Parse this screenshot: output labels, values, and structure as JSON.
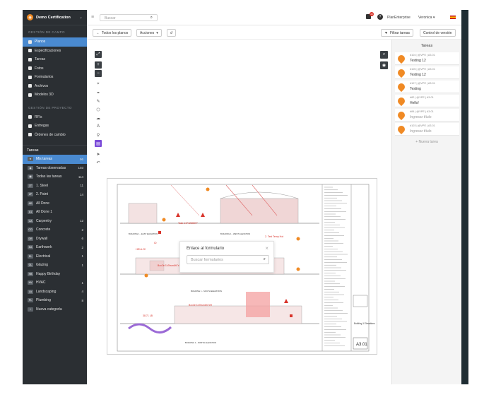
{
  "sidebar": {
    "brand": "Demo Certification",
    "section_field": "GESTIÓN DE CAMPO",
    "field_items": [
      {
        "label": "Planos",
        "icon": "map-icon",
        "active": true
      },
      {
        "label": "Especificaciones",
        "icon": "doc-icon"
      },
      {
        "label": "Tareas",
        "icon": "list-icon"
      },
      {
        "label": "Fotos",
        "icon": "camera-icon"
      },
      {
        "label": "Formularios",
        "icon": "form-icon"
      },
      {
        "label": "Archivos",
        "icon": "attach-icon"
      },
      {
        "label": "Modelos 3D",
        "icon": "cube-icon"
      }
    ],
    "section_project": "GESTIÓN DE PROYECTO",
    "project_items": [
      {
        "label": "RFIs",
        "icon": "rfi-icon"
      },
      {
        "label": "Entregas",
        "icon": "person-icon"
      },
      {
        "label": "Órdenes de cambio",
        "icon": "change-icon"
      }
    ],
    "tasks_header": "Tareas",
    "task_filters": [
      {
        "badge": "★",
        "label": "Mis tareas",
        "count": "96",
        "active": true
      },
      {
        "badge": "◉",
        "label": "Tareas observadas",
        "count": "103"
      },
      {
        "badge": "▦",
        "label": "Todas las tareas",
        "count": "114"
      },
      {
        "badge": "1T",
        "label": "1. Steel",
        "count": "11"
      },
      {
        "badge": "2P",
        "label": "2. Paint",
        "count": "14"
      },
      {
        "badge": "AD",
        "label": "All Done",
        "count": ""
      },
      {
        "badge": "A1",
        "label": "All Done 1",
        "count": ""
      },
      {
        "badge": "CA",
        "label": "Carpentry",
        "count": "12"
      },
      {
        "badge": "CO",
        "label": "Concrete",
        "count": "2"
      },
      {
        "badge": "DR",
        "label": "Drywall",
        "count": "6"
      },
      {
        "badge": "EA",
        "label": "Earthwork",
        "count": "2"
      },
      {
        "badge": "EL",
        "label": "Electrical",
        "count": "1"
      },
      {
        "badge": "GL",
        "label": "Glazing",
        "count": "1"
      },
      {
        "badge": "HB",
        "label": "Happy Birthday",
        "count": ""
      },
      {
        "badge": "HV",
        "label": "HVAC",
        "count": "1"
      },
      {
        "badge": "LA",
        "label": "Landscaping",
        "count": "4"
      },
      {
        "badge": "PL",
        "label": "Plumbing",
        "count": "8"
      },
      {
        "badge": "+",
        "label": "Nueva categoría",
        "count": ""
      }
    ]
  },
  "topbar": {
    "search_placeholder": "Buscar",
    "notification_count": "20",
    "plan": "PlanEnterprise",
    "user": "Veronica ▾"
  },
  "toolbar": {
    "back": "Todos los planos",
    "actions": "Acciones",
    "filter": "Filtrar tareas",
    "version": "Control de versión"
  },
  "right_panel": {
    "title": "Tareas",
    "tasks": [
      {
        "ref": "#104 | @VPE | A3.01",
        "name": "Testing 12",
        "color": "#f08a24"
      },
      {
        "ref": "#105 | @VPE | A3.01",
        "name": "Testing 12",
        "color": "#f08a24"
      },
      {
        "ref": "#107 | @VPE | A3.01",
        "name": "Testing",
        "color": "#f08a24"
      },
      {
        "ref": "#82 | @VPE | A3.01",
        "name": "Hello!",
        "color": "#f08a24"
      },
      {
        "ref": "#84 | @VPE | A3.01",
        "name": "Ingresar título",
        "color": "#f08a24",
        "muted": true
      },
      {
        "ref": "#103 | @VPE | A3.01",
        "name": "Ingresar título",
        "color": "#f08a24",
        "muted": true
      }
    ],
    "new_task": "+ Nueva tarea"
  },
  "modal": {
    "title": "Enlace al formulario",
    "search_placeholder": "Buscar formularios"
  },
  "drawing": {
    "sheet_number": "A3.01",
    "sheet_title": "Building 1 Elevations",
    "labels": {
      "task_1": "Task 1474260877",
      "task_2": "2. Test Temp Hot",
      "task_3": "BxxOn7a7fwm6hTxT",
      "task_4": "BxxOn7a7fwm6hTxR",
      "task_5": "38.71 LB",
      "hello": "HELLO!",
      "id": "ID",
      "elev_1": "BUILDING 1 - EAST ELEVATION",
      "elev_2": "BUILDING 1 - WEST ELEVATION",
      "elev_3": "BUILDING 1 - SOUTH ELEVATION",
      "elev_4": "BUILDING 1 - NORTH ELEVATION"
    }
  }
}
